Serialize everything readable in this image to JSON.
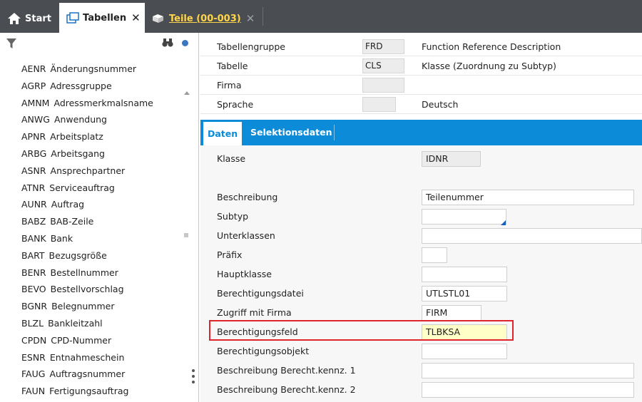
{
  "tabs": [
    {
      "label": "Start",
      "icon": "home-icon"
    },
    {
      "label": "Tabellen",
      "icon": "window-icon",
      "close": "✕"
    },
    {
      "label": "Teile (00-003)",
      "icon": "parts-icon",
      "close": "✕"
    }
  ],
  "sidebar": {
    "items": [
      {
        "code": "AENR",
        "name": "Änderungsnummer"
      },
      {
        "code": "AGRP",
        "name": "Adressgruppe"
      },
      {
        "code": "AMNM",
        "name": "Adressmerkmalsname"
      },
      {
        "code": "ANWG",
        "name": "Anwendung"
      },
      {
        "code": "APNR",
        "name": "Arbeitsplatz"
      },
      {
        "code": "ARBG",
        "name": "Arbeitsgang"
      },
      {
        "code": "ASNR",
        "name": "Ansprechpartner"
      },
      {
        "code": "ATNR",
        "name": "Serviceauftrag"
      },
      {
        "code": "AUNR",
        "name": "Auftrag"
      },
      {
        "code": "BABZ",
        "name": "BAB-Zeile"
      },
      {
        "code": "BANK",
        "name": "Bank"
      },
      {
        "code": "BART",
        "name": "Bezugsgröße"
      },
      {
        "code": "BENR",
        "name": "Bestellnummer"
      },
      {
        "code": "BEVO",
        "name": "Bestellvorschlag"
      },
      {
        "code": "BGNR",
        "name": "Belegnummer"
      },
      {
        "code": "BLZL",
        "name": "Bankleitzahl"
      },
      {
        "code": "CPDN",
        "name": "CPD-Nummer"
      },
      {
        "code": "ESNR",
        "name": "Entnahmeschein"
      },
      {
        "code": "FAUG",
        "name": "Auftragsnummer"
      },
      {
        "code": "FAUN",
        "name": "Fertigungsauftrag"
      }
    ]
  },
  "header": {
    "rows": [
      {
        "label": "Tabellengruppe",
        "value": "FRD",
        "desc": "Function Reference Description"
      },
      {
        "label": "Tabelle",
        "value": "CLS",
        "desc": "Klasse (Zuordnung zu Subtyp)"
      },
      {
        "label": "Firma",
        "value": "",
        "desc": ""
      },
      {
        "label": "Sprache",
        "value": "",
        "desc": "Deutsch"
      }
    ]
  },
  "subtabs": {
    "daten": "Daten",
    "selektion": "Selektionsdaten"
  },
  "form": {
    "klasse": {
      "label": "Klasse",
      "value": "IDNR"
    },
    "beschreibung": {
      "label": "Beschreibung",
      "value": "Teilenummer"
    },
    "subtyp": {
      "label": "Subtyp",
      "value": ""
    },
    "unterklassen": {
      "label": "Unterklassen",
      "value": ""
    },
    "praefix": {
      "label": "Präfix",
      "value": ""
    },
    "hauptklasse": {
      "label": "Hauptklasse",
      "value": ""
    },
    "berechtigungsdatei": {
      "label": "Berechtigungsdatei",
      "value": "UTLSTL01"
    },
    "zugriff": {
      "label": "Zugriff mit Firma",
      "value": "FIRM"
    },
    "berechtigungsfeld": {
      "label": "Berechtigungsfeld",
      "value": "TLBKSA"
    },
    "berechtigungsobjekt": {
      "label": "Berechtigungsobjekt",
      "value": ""
    },
    "beschr1": {
      "label": "Beschreibung Berecht.kennz. 1",
      "value": ""
    },
    "beschr2": {
      "label": "Beschreibung Berecht.kennz. 2",
      "value": ""
    }
  },
  "colors": {
    "topbar": "#4a4d51",
    "accent": "#0b8bd8",
    "highlight": "#e0242b",
    "tab_link": "#ffd54a"
  }
}
